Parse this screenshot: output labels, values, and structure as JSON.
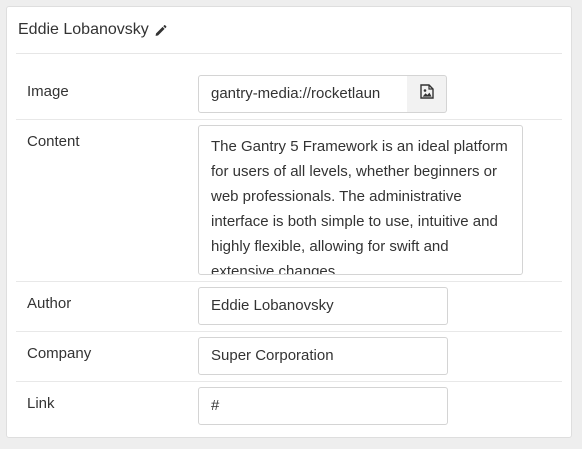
{
  "header": {
    "title": "Eddie Lobanovsky",
    "edit_icon": "pencil-icon"
  },
  "fields": {
    "image": {
      "label": "Image",
      "value": "gantry-media://rocketlaun",
      "picker_icon": "image-file-icon"
    },
    "content": {
      "label": "Content",
      "value": "The Gantry 5 Framework is an ideal platform for users of all levels, whether beginners or web professionals. The administrative interface is both simple to use, intuitive and highly flexible, allowing for swift and extensive changes"
    },
    "author": {
      "label": "Author",
      "value": "Eddie Lobanovsky"
    },
    "company": {
      "label": "Company",
      "value": "Super Corporation"
    },
    "link": {
      "label": "Link",
      "value": "#"
    }
  },
  "colors": {
    "background": "#eeeeee",
    "card": "#ffffff",
    "border": "#d4d4d4",
    "text": "#333333"
  }
}
